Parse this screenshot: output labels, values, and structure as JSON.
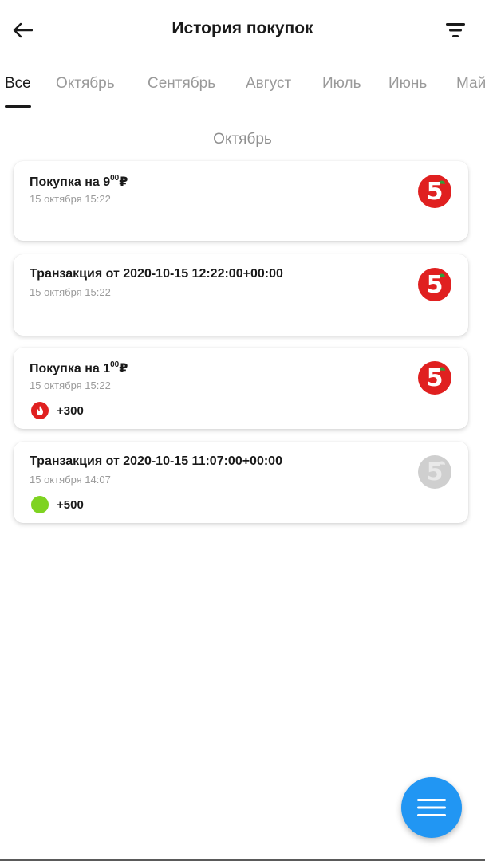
{
  "header": {
    "title": "История покупок"
  },
  "tabs": [
    {
      "label": "Все"
    },
    {
      "label": "Октябрь"
    },
    {
      "label": "Сентябрь"
    },
    {
      "label": "Август"
    },
    {
      "label": "Июль"
    },
    {
      "label": "Июнь"
    },
    {
      "label": "Май"
    }
  ],
  "section": {
    "title": "Октябрь"
  },
  "cards": [
    {
      "title": "Покупка на 9",
      "title_sup": "00",
      "currency": "₽",
      "date": "15 октября 15:22",
      "logo": "pyaterochka-logo"
    },
    {
      "title": "Транзакция от 2020-10-15 12:22:00+00:00",
      "date": "15 октября 15:22",
      "logo": "pyaterochka-logo"
    },
    {
      "title": "Покупка на 1",
      "title_sup": "00",
      "currency": "₽",
      "date": "15 октября 15:22",
      "logo": "pyaterochka-logo",
      "bonus": "+300",
      "bonus_icon": "flame-icon"
    },
    {
      "title": "Транзакция от 2020-10-15 11:07:00+00:00",
      "date": "15 октября 14:07",
      "logo": "pyaterochka-logo-gray",
      "bonus": "+500",
      "bonus_icon": "green-dot-icon"
    }
  ],
  "colors": {
    "brand_red": "#e02020",
    "brand_green": "#2fa03a",
    "fab_blue": "#2196f3",
    "bonus_green": "#7ed321"
  }
}
